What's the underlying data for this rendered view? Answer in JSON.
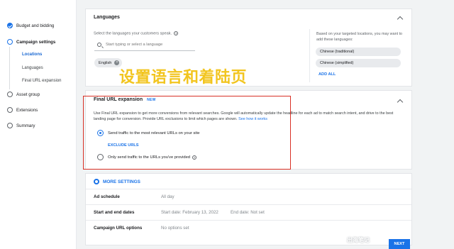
{
  "sidebar": {
    "items": [
      {
        "label": "Budget and bidding"
      },
      {
        "label": "Campaign settings"
      },
      {
        "label": "Asset group"
      },
      {
        "label": "Extensions"
      },
      {
        "label": "Summary"
      }
    ],
    "subitems": [
      {
        "label": "Locations"
      },
      {
        "label": "Languages"
      },
      {
        "label": "Final URL expansion"
      }
    ]
  },
  "languages": {
    "title": "Languages",
    "hint": "Select the languages your customers speak.",
    "search_placeholder": "Start typing or select a language",
    "selected_chip": "English",
    "suggest_text": "Based on your targeted locations, you may want to add these languages:",
    "suggestions": [
      "Chinese (traditional)",
      "Chinese (simplified)"
    ],
    "add_all": "ADD ALL"
  },
  "annotation": "设置语言和着陆页",
  "final_url": {
    "title": "Final URL expansion",
    "badge": "NEW",
    "description": "Use Final URL expansion to get more conversions from relevant searches. Google will automatically update the headline for each ad to match search intent, and drive to the best landing page for conversion. Provide URL exclusions to limit which pages are shown.",
    "link": "See how it works",
    "option_on": "Send traffic to the most relevant URLs on your site",
    "exclude": "EXCLUDE URLS",
    "option_off": "Only send traffic to the URLs you've provided"
  },
  "more": {
    "label": "MORE SETTINGS",
    "rows": [
      {
        "label": "Ad schedule",
        "value": "All day",
        "value2": ""
      },
      {
        "label": "Start and end dates",
        "value": "Start date: February 13, 2022",
        "value2": "End date: Not set"
      },
      {
        "label": "Campaign URL options",
        "value": "No options set",
        "value2": ""
      }
    ]
  },
  "next_label": "NEXT",
  "watermark": "出海笔记"
}
